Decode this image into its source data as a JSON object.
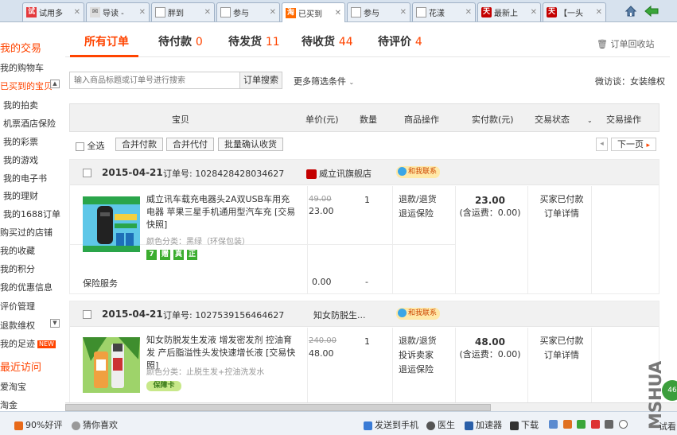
{
  "browser": {
    "tabs": [
      {
        "label": "试用多",
        "icon": "试"
      },
      {
        "label": "导读 -",
        "icon": "✉"
      },
      {
        "label": "胖到",
        "icon": ""
      },
      {
        "label": "参与",
        "icon": ""
      },
      {
        "label": "已买到",
        "icon": "淘"
      },
      {
        "label": "参与",
        "icon": ""
      },
      {
        "label": "花漾",
        "icon": ""
      },
      {
        "label": "最新上",
        "icon": "天"
      },
      {
        "label": "【一头",
        "icon": "天"
      }
    ]
  },
  "sidebar": {
    "title_mytrade": "我的交易",
    "items_trade": [
      "我的购物车",
      "已买到的宝贝",
      "我的拍卖",
      "机票酒店保险",
      "我的彩票",
      "我的游戏",
      "我的电子书",
      "我的理财",
      "我的1688订单",
      "购买过的店铺",
      "我的收藏",
      "我的积分",
      "我的优惠信息",
      "评价管理",
      "退款维权",
      "我的足迹"
    ],
    "new_badge": "NEW",
    "title_recent": "最近访问",
    "items_recent": [
      "爱淘宝",
      "淘金"
    ]
  },
  "order_tabs": [
    {
      "label": "所有订单",
      "count": ""
    },
    {
      "label": "待付款",
      "count": "0"
    },
    {
      "label": "待发货",
      "count": "11"
    },
    {
      "label": "待收货",
      "count": "44"
    },
    {
      "label": "待评价",
      "count": "4"
    }
  ],
  "recycle": "订单回收站",
  "search": {
    "placeholder": "输入商品标题或订单号进行搜索",
    "button": "订单搜索",
    "more_filter": "更多筛选条件",
    "weiguan": "微访谈：女装维权"
  },
  "table_header": [
    "宝贝",
    "单价(元)",
    "数量",
    "商品操作",
    "实付款(元)",
    "交易状态",
    "交易操作"
  ],
  "batch": {
    "select_all": "全选",
    "merge_pay": "合并付款",
    "merge_proxy": "合并代付",
    "batch_confirm": "批量确认收货",
    "next": "下一页"
  },
  "orders": [
    {
      "date": "2015-04-21",
      "order_no_label": "订单号:",
      "order_no": "1028428428034627",
      "shop": "威立讯旗舰店",
      "contact": "和我联系",
      "title": "威立讯车载充电器头2A双USB车用充电器 苹果三星手机通用型汽车充 [交易快照]",
      "variant": "颜色分类：黑绿（环保包装）",
      "orig_price": "49.00",
      "price": "23.00",
      "qty": "1",
      "ops": [
        "退款/退货",
        "退运保险"
      ],
      "paid": "23.00",
      "ship": "(含运费：0.00)",
      "status": [
        "买家已付款",
        "订单详情"
      ],
      "tags": [
        "7",
        "赠",
        "真",
        "正"
      ],
      "insurance": "保险服务",
      "ins_price": "0.00",
      "ins_qty": "-"
    },
    {
      "date": "2015-04-21",
      "order_no_label": "订单号:",
      "order_no": "1027539156464627",
      "shop": "知女防脱生...",
      "contact": "和我联系",
      "title": "知女防脱发生发液 增发密发剂 控油育发 产后脂溢性头发快速增长液 [交易快照]",
      "variant": "颜色分类：止脱生发+控油洗发水",
      "orig_price": "240.00",
      "price": "48.00",
      "qty": "1",
      "ops": [
        "退款/退货",
        "投诉卖家",
        "退运保险"
      ],
      "paid": "48.00",
      "ship": "(含运费：0.00)",
      "status": [
        "买家已付款",
        "订单详情"
      ],
      "tags": [
        "保障卡"
      ]
    }
  ],
  "statusbar": {
    "rating": "90%好评",
    "guess": "猜你喜欢",
    "send_phone": "发送到手机",
    "doctor": "医生",
    "accelerator": "加速器",
    "download": "下载",
    "zoom": "试看"
  },
  "watermark": "MSHUA",
  "float_badge": "46"
}
